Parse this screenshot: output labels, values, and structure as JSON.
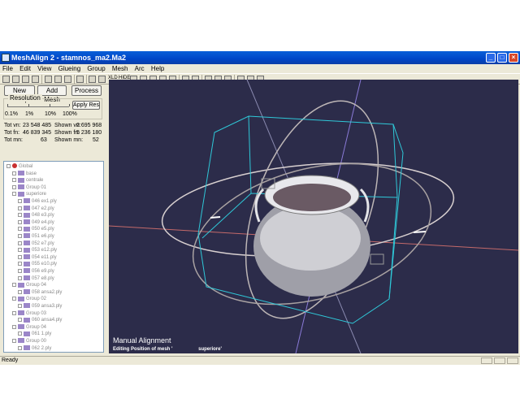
{
  "window": {
    "title": "MeshAlign 2 - stamnos_ma2.Ma2",
    "min": "_",
    "max": "□",
    "close": "×"
  },
  "menu": [
    "File",
    "Edit",
    "View",
    "Glueing",
    "Group",
    "Mesh",
    "Arc",
    "Help"
  ],
  "toolbar": {
    "text_item": "XLD",
    "text_item2": "HIDE"
  },
  "buttons": {
    "new_group": "New Group",
    "add_mesh": "Add Mesh",
    "process": "Process",
    "apply_res": "Apply Res"
  },
  "resolution": {
    "label": "Resolution",
    "ticks": [
      "0.1%",
      "1%",
      "10%",
      "100%"
    ],
    "value": "10%"
  },
  "stats": [
    {
      "k1": "Tot vn:",
      "v1": "23 548 485",
      "k2": "Shown vn:",
      "v2": "2 695 968"
    },
    {
      "k1": "Tot fn:",
      "v1": "46 839 345",
      "k2": "Shown fn:",
      "v2": "5 236 180"
    },
    {
      "k1": "Tot mn:",
      "v1": "63",
      "k2": "Shown mn:",
      "v2": "52"
    }
  ],
  "tree": [
    {
      "label": "Global",
      "level": 0
    },
    {
      "label": "base",
      "level": 1
    },
    {
      "label": "centrale",
      "level": 1
    },
    {
      "label": "Group 01",
      "level": 1
    },
    {
      "label": "superiore",
      "level": 1
    },
    {
      "label": "046 ex1.ply",
      "level": 2
    },
    {
      "label": "047 e2.ply",
      "level": 2
    },
    {
      "label": "048 e3.ply",
      "level": 2
    },
    {
      "label": "049 e4.ply",
      "level": 2
    },
    {
      "label": "050 e5.ply",
      "level": 2
    },
    {
      "label": "051 e6.ply",
      "level": 2
    },
    {
      "label": "052 e7.ply",
      "level": 2
    },
    {
      "label": "053 e12.ply",
      "level": 2
    },
    {
      "label": "054 e11.ply",
      "level": 2
    },
    {
      "label": "055 e10.ply",
      "level": 2
    },
    {
      "label": "056 e9.ply",
      "level": 2
    },
    {
      "label": "057 e8.ply",
      "level": 2
    },
    {
      "label": "Group 04",
      "level": 1
    },
    {
      "label": "058 ansa2.ply",
      "level": 2
    },
    {
      "label": "Group 02",
      "level": 1
    },
    {
      "label": "059 ansa3.ply",
      "level": 2
    },
    {
      "label": "Group 03",
      "level": 1
    },
    {
      "label": "060 ansa4.ply",
      "level": 2
    },
    {
      "label": "Group 04",
      "level": 1
    },
    {
      "label": "061 1.ply",
      "level": 2
    },
    {
      "label": "Group 00",
      "level": 1
    },
    {
      "label": "062 2.ply",
      "level": 2
    }
  ],
  "viewport": {
    "title": "Manual Alignment",
    "status_prefix": "Editing Position of mesh '",
    "status_mesh": "superiore'"
  },
  "status": {
    "text": "Ready"
  },
  "colors": {
    "viewport_bg": "#2c2c4a",
    "box": "#2fc8d8",
    "gizmo": "#d8d0d0"
  }
}
